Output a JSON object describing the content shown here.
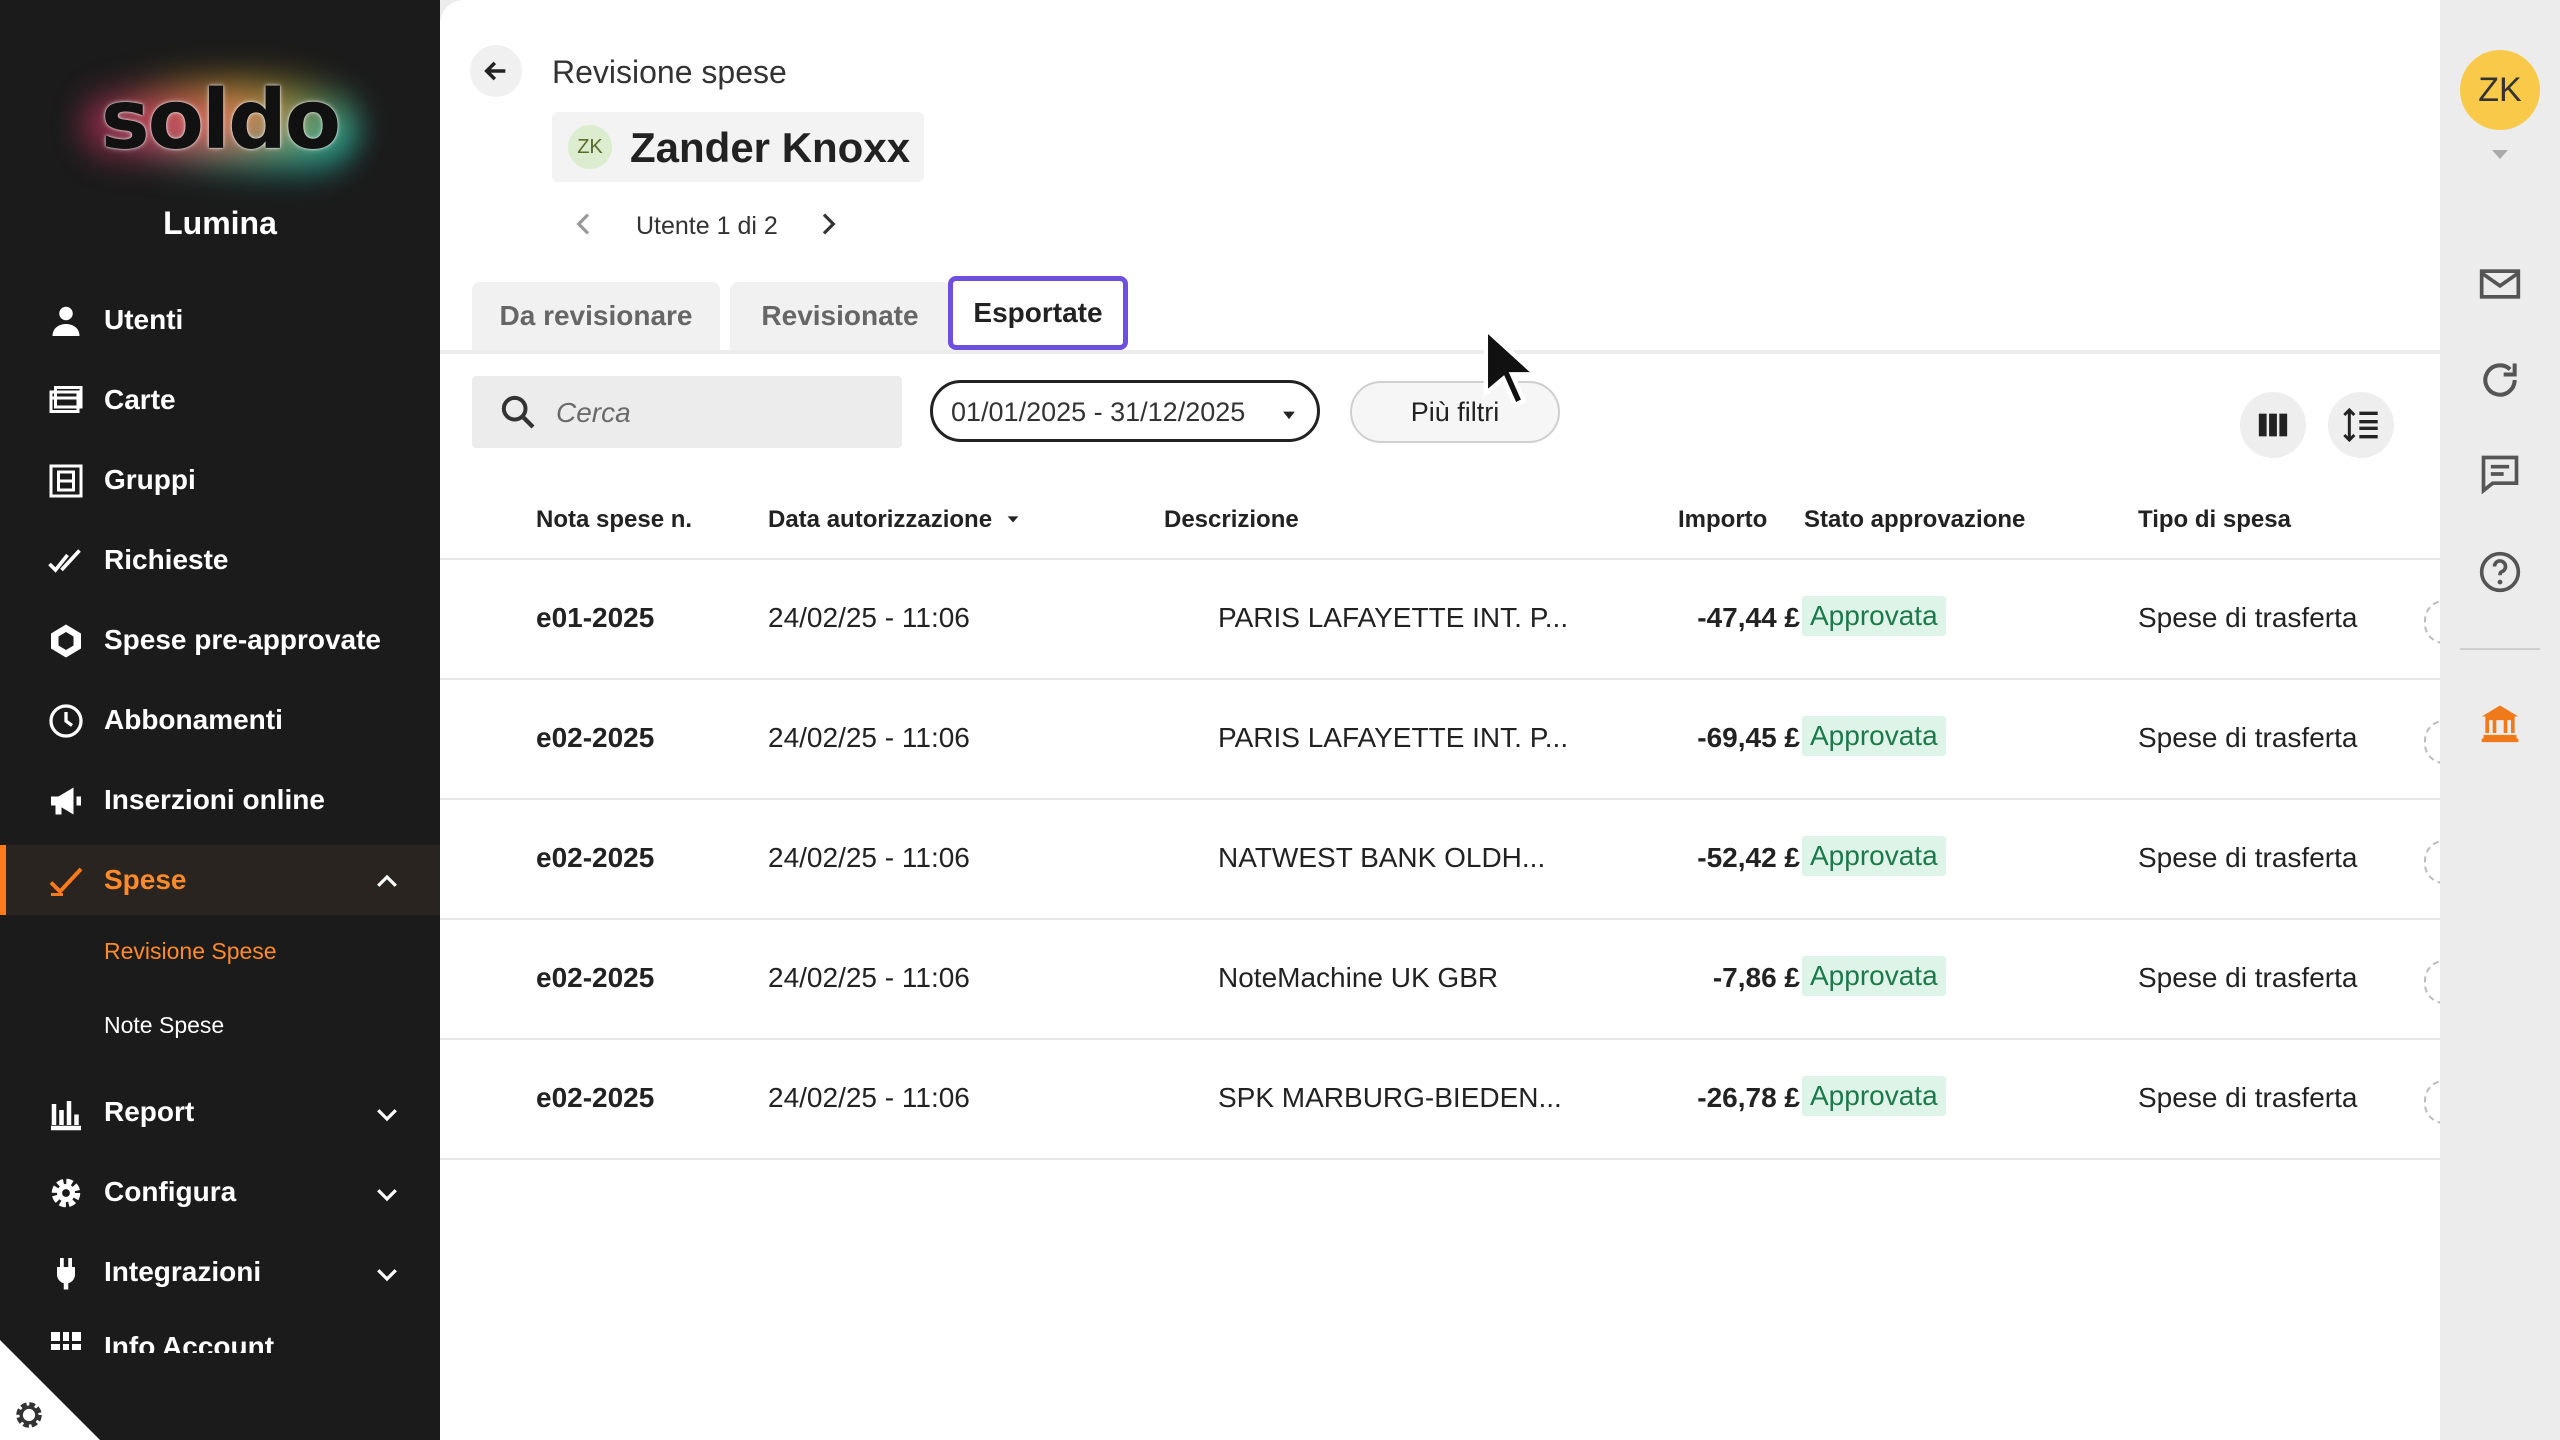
{
  "sidebar": {
    "brand": "soldo",
    "company": "Lumina",
    "items": [
      {
        "label": "Utenti"
      },
      {
        "label": "Carte"
      },
      {
        "label": "Gruppi"
      },
      {
        "label": "Richieste"
      },
      {
        "label": "Spese pre-approvate"
      },
      {
        "label": "Abbonamenti"
      },
      {
        "label": "Inserzioni online"
      },
      {
        "label": "Spese"
      },
      {
        "label": "Report"
      },
      {
        "label": "Configura"
      },
      {
        "label": "Integrazioni"
      },
      {
        "label": "Info Account"
      }
    ],
    "subitems": [
      {
        "label": "Revisione Spese",
        "active": true
      },
      {
        "label": "Note Spese",
        "active": false
      }
    ],
    "accent_color": "#ff7a1a"
  },
  "header": {
    "title": "Revisione spese",
    "user": {
      "initials": "ZK",
      "name": "Zander Knoxx"
    },
    "pager": "Utente 1 di 2"
  },
  "tabs": [
    {
      "label": "Da revisionare",
      "selected": false
    },
    {
      "label": "Revisionate",
      "selected": false
    },
    {
      "label": "Esportate",
      "selected": true
    }
  ],
  "filters": {
    "search_placeholder": "Cerca",
    "date_range": "01/01/2025 - 31/12/2025",
    "more_filters": "Più filtri"
  },
  "table": {
    "columns": [
      "Nota spese n.",
      "Data autorizzazione",
      "Descrizione",
      "Importo",
      "Stato approvazione",
      "Tipo di spesa"
    ],
    "rows": [
      {
        "num": "e01-2025",
        "date": "24/02/25 - 11:06",
        "desc": "PARIS LAFAYETTE INT. P...",
        "amount": "-47,44 £",
        "status": "Approvata",
        "type": "Spese di trasferta"
      },
      {
        "num": "e02-2025",
        "date": "24/02/25 - 11:06",
        "desc": "PARIS LAFAYETTE INT. P...",
        "amount": "-69,45 £",
        "status": "Approvata",
        "type": "Spese di trasferta"
      },
      {
        "num": "e02-2025",
        "date": "24/02/25 - 11:06",
        "desc": "NATWEST BANK OLDH...",
        "amount": "-52,42 £",
        "status": "Approvata",
        "type": "Spese di trasferta"
      },
      {
        "num": "e02-2025",
        "date": "24/02/25 - 11:06",
        "desc": "NoteMachine UK GBR",
        "amount": "-7,86 £",
        "status": "Approvata",
        "type": "Spese di trasferta"
      },
      {
        "num": "e02-2025",
        "date": "24/02/25 - 11:06",
        "desc": "SPK MARBURG-BIEDEN...",
        "amount": "-26,78 £",
        "status": "Approvata",
        "type": "Spese di trasferta"
      }
    ]
  },
  "rail": {
    "avatar_initials": "ZK",
    "icons": [
      "mail-icon",
      "refresh-icon",
      "chat-icon",
      "help-icon",
      "bank-icon"
    ]
  },
  "colors": {
    "tab_highlight": "#6e4fe0",
    "status_bg": "#dff4e8",
    "status_text": "#1c7a4a",
    "bank_icon": "#f07a1a"
  }
}
